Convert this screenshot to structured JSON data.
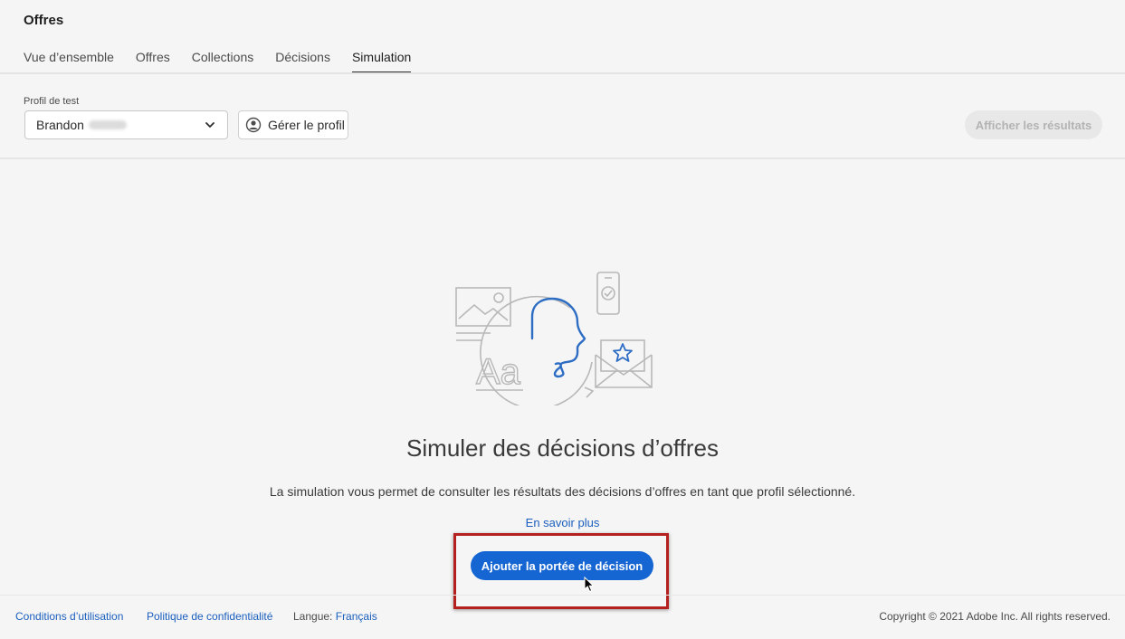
{
  "app": {
    "title": "Offres"
  },
  "tabs": [
    {
      "label": "Vue d’ensemble",
      "active": false
    },
    {
      "label": "Offres",
      "active": false
    },
    {
      "label": "Collections",
      "active": false
    },
    {
      "label": "Décisions",
      "active": false
    },
    {
      "label": "Simulation",
      "active": true
    }
  ],
  "toolbar": {
    "profile_label": "Profil de test",
    "profile_value": "Brandon",
    "manage_label": "Gérer le profil",
    "results_label": "Afficher les résultats"
  },
  "empty_state": {
    "title": "Simuler des décisions d’offres",
    "description": "La simulation vous permet de consulter les résultats des décisions d’offres en tant que profil sélectionné.",
    "learn_more": "En savoir plus",
    "add_scope_label": "Ajouter la portée de décision",
    "illustration_text": "Aa"
  },
  "footer": {
    "terms": "Conditions d’utilisation",
    "privacy": "Politique de confidentialité",
    "language_label": "Langue:",
    "language_value": "Français",
    "copyright": "Copyright ©  2021 Adobe Inc.  All rights reserved."
  },
  "colors": {
    "accent": "#1565d3",
    "link": "#1b5fbe",
    "highlight": "#b3201e",
    "illustration_blue": "#2d6dc4",
    "illustration_gray": "#b8b8b8"
  }
}
